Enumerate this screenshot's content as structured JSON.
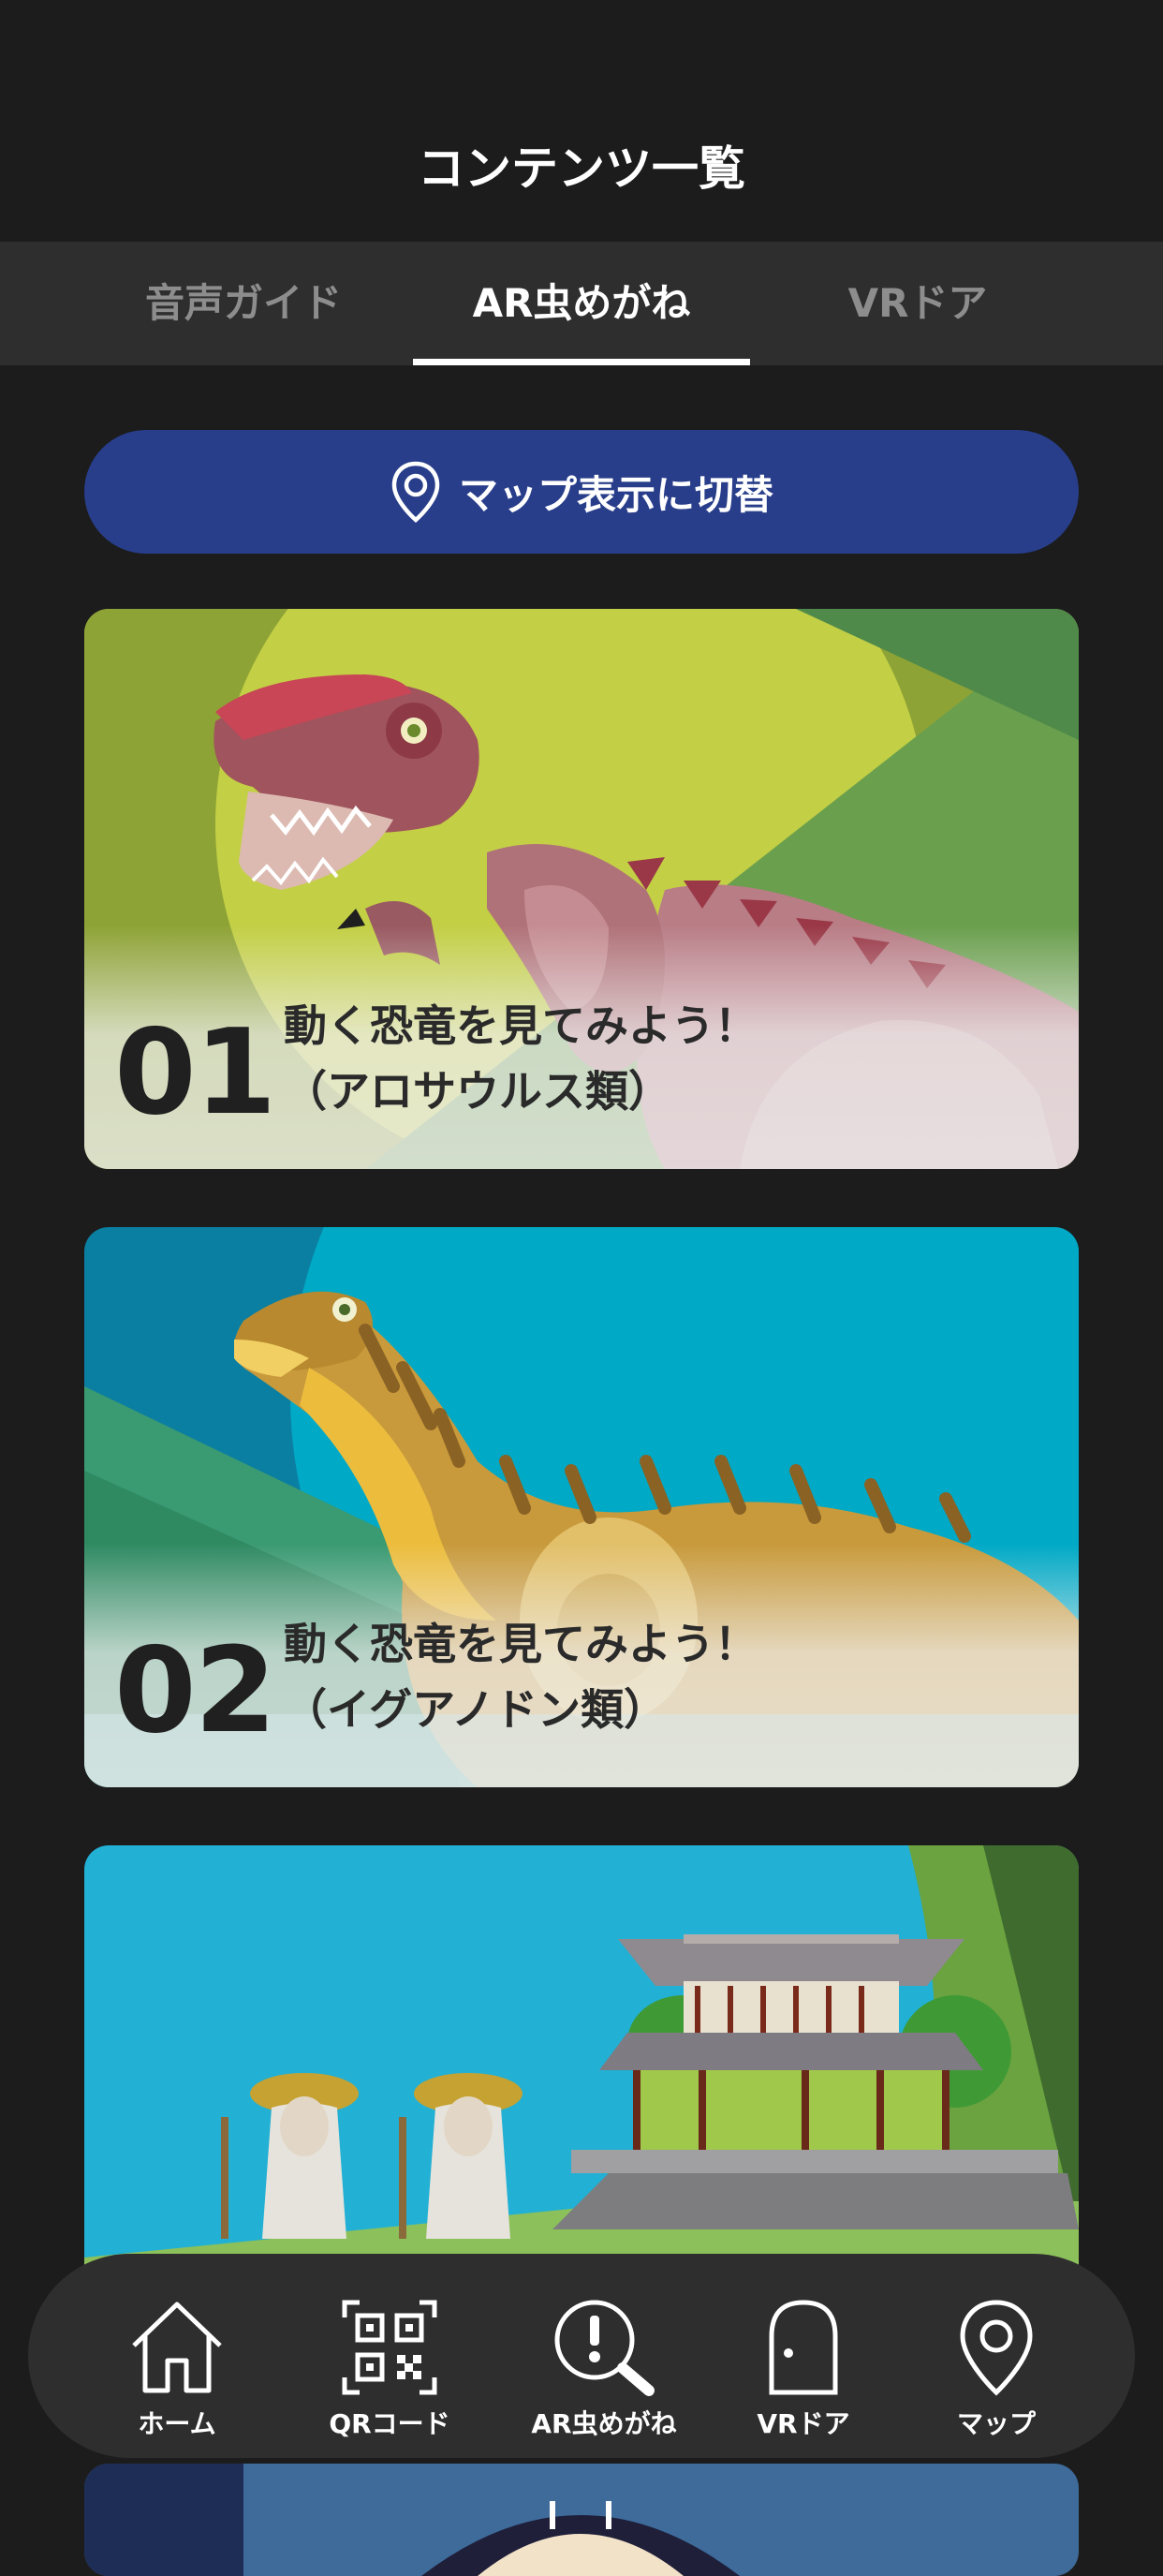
{
  "header": {
    "title": "コンテンツ一覧"
  },
  "tabs": [
    {
      "label": "音声ガイド",
      "active": false
    },
    {
      "label": "AR虫めがね",
      "active": true
    },
    {
      "label": "VRドア",
      "active": false
    }
  ],
  "map_toggle": {
    "label": "マップ表示に切替",
    "icon": "map-pin-icon"
  },
  "cards": [
    {
      "number": "01",
      "title_line1": "動く恐竜を見てみよう！",
      "title_line2": "（アロサウルス類）"
    },
    {
      "number": "02",
      "title_line1": "動く恐竜を見てみよう！",
      "title_line2": "（イグアノドン類）"
    }
  ],
  "bottom_nav": [
    {
      "label": "ホーム",
      "icon": "home-icon"
    },
    {
      "label": "QRコード",
      "icon": "qr-code-icon"
    },
    {
      "label": "AR虫めがね",
      "icon": "ar-magnifier-icon"
    },
    {
      "label": "VRドア",
      "icon": "door-icon"
    },
    {
      "label": "マップ",
      "icon": "map-pin-icon"
    }
  ],
  "colors": {
    "background": "#1c1c1d",
    "tabbar": "#2e2e2f",
    "accent_button": "#283e8a",
    "text": "#ffffff",
    "inactive_tab": "#8d8d8d"
  }
}
